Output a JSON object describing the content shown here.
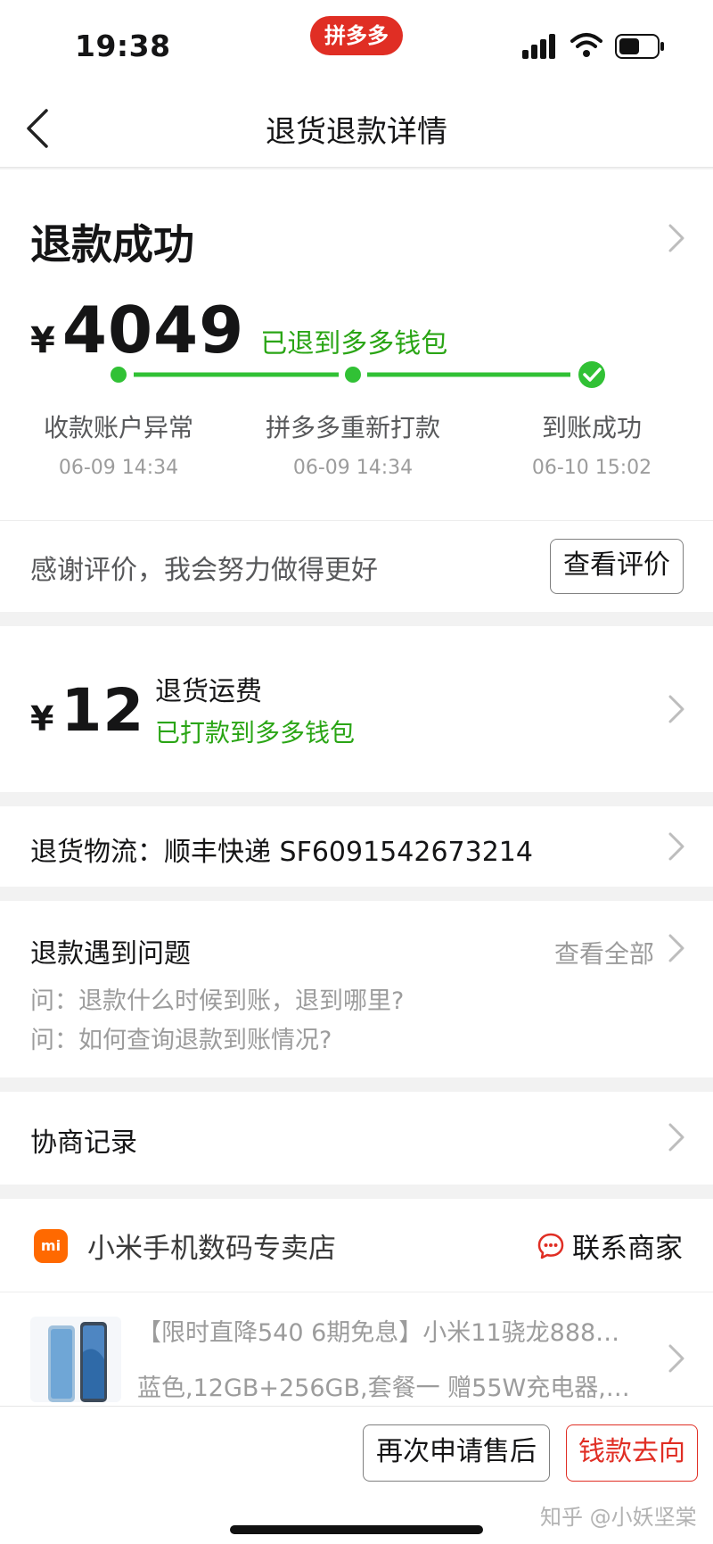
{
  "status_bar": {
    "time": "19:38",
    "app_badge": "拼多多"
  },
  "nav": {
    "title": "退货退款详情"
  },
  "refund": {
    "status": "退款成功",
    "currency": "¥",
    "amount": "4049",
    "destination": "已退到多多钱包",
    "steps": [
      {
        "name": "收款账户异常",
        "time": "06-09 14:34"
      },
      {
        "name": "拼多多重新打款",
        "time": "06-09 14:34"
      },
      {
        "name": "到账成功",
        "time": "06-10 15:02"
      }
    ]
  },
  "evaluation": {
    "text": "感谢评价，我会努力做得更好",
    "button": "查看评价"
  },
  "shipping_fee": {
    "currency": "¥",
    "amount": "12",
    "label": "退货运费",
    "status": "已打款到多多钱包"
  },
  "logistics": {
    "text": "退货物流：顺丰快递 SF6091542673214"
  },
  "faq": {
    "title": "退款遇到问题",
    "view_all": "查看全部",
    "questions": [
      "问：退款什么时候到账，退到哪里?",
      "问：如何查询退款到账情况?"
    ]
  },
  "negotiation": {
    "title": "协商记录"
  },
  "shop": {
    "logo_text": "mi",
    "name": "小米手机数码专卖店",
    "contact": "联系商家",
    "product_title": "【限时直降540 6期免息】小米11骁龙888…",
    "product_spec": "蓝色,12GB+256GB,套餐一 赠55W充电器,…"
  },
  "bottom": {
    "reapply": "再次申请售后",
    "money_flow": "钱款去向",
    "watermark": "知乎 @小妖坚棠"
  },
  "colors": {
    "accent_green": "#2aa515",
    "brand_red": "#e02e24",
    "step_green": "#31c135"
  }
}
